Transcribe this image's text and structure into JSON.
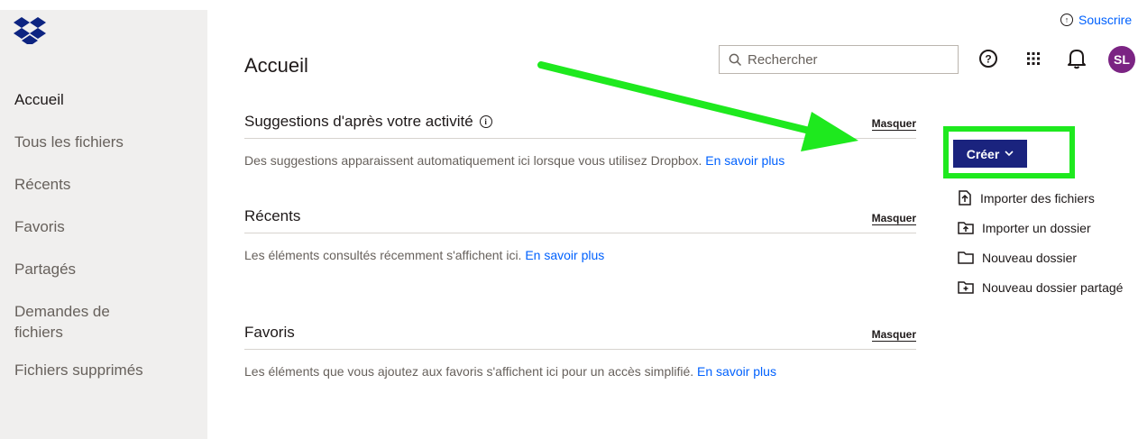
{
  "sidebar": {
    "logo_icon": "dropbox-logo",
    "items": [
      {
        "label": "Accueil",
        "active": true
      },
      {
        "label": "Tous les fichiers",
        "active": false
      },
      {
        "label": "Récents",
        "active": false
      },
      {
        "label": "Favoris",
        "active": false
      },
      {
        "label": "Partagés",
        "active": false
      },
      {
        "label": "Demandes de fichiers",
        "active": false
      },
      {
        "label": "Fichiers supprimés",
        "active": false
      }
    ]
  },
  "header": {
    "title": "Accueil",
    "subscribe_label": "Souscrire",
    "search_placeholder": "Rechercher",
    "help_icon": "help-icon",
    "apps_icon": "apps-grid-icon",
    "notifications_icon": "bell-icon",
    "avatar_initials": "SL",
    "avatar_color": "#7b2483"
  },
  "sections": [
    {
      "title": "Suggestions d'après votre activité",
      "hide_label": "Masquer",
      "body": "Des suggestions apparaissent automatiquement ici lorsque vous utilisez Dropbox.",
      "link": "En savoir plus"
    },
    {
      "title": "Récents",
      "hide_label": "Masquer",
      "body": "Les éléments consultés récemment s'affichent ici.",
      "link": "En savoir plus"
    },
    {
      "title": "Favoris",
      "hide_label": "Masquer",
      "body": "Les éléments que vous ajoutez aux favoris s'affichent ici pour un accès simplifié.",
      "link": "En savoir plus"
    }
  ],
  "create": {
    "button_label": "Créer",
    "button_color": "#1a237e",
    "highlight_color": "#1ee91e",
    "menu": [
      {
        "label": "Importer des fichiers",
        "icon": "upload-file-icon"
      },
      {
        "label": "Importer un dossier",
        "icon": "upload-folder-icon"
      },
      {
        "label": "Nouveau dossier",
        "icon": "folder-icon"
      },
      {
        "label": "Nouveau dossier partagé",
        "icon": "shared-folder-icon"
      }
    ]
  },
  "colors": {
    "link": "#0061fe",
    "sidebar_bg": "#f0efee",
    "annotation_arrow": "#1ee91e"
  }
}
